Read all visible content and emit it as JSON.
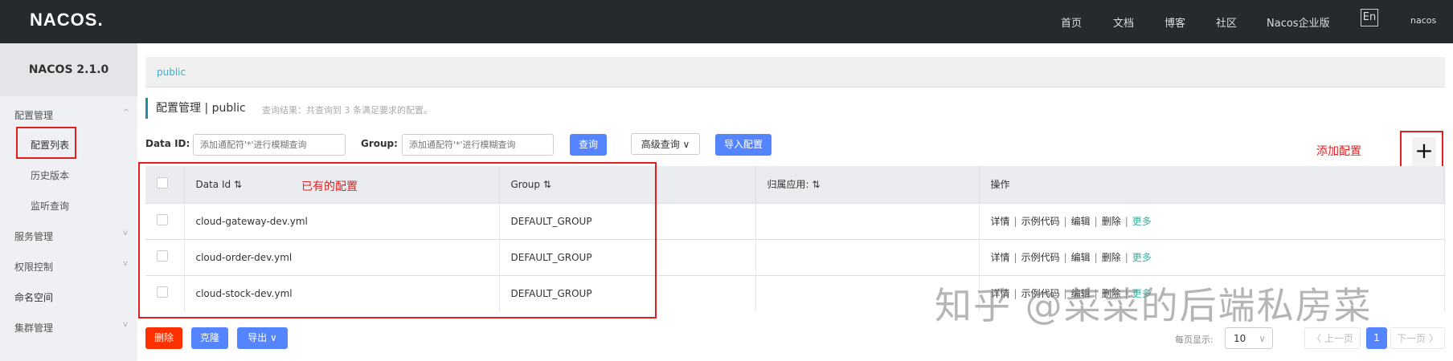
{
  "header": {
    "logo": "NACOS.",
    "nav": [
      "首页",
      "文档",
      "博客",
      "社区",
      "Nacos企业版"
    ],
    "lang": "En",
    "user": "nacos"
  },
  "sidebar": {
    "version": "NACOS 2.1.0",
    "items": [
      {
        "label": "配置管理",
        "chev": "^"
      },
      {
        "label": "配置列表"
      },
      {
        "label": "历史版本"
      },
      {
        "label": "监听查询"
      },
      {
        "label": "服务管理",
        "chev": "v"
      },
      {
        "label": "权限控制",
        "chev": "v"
      },
      {
        "label": "命名空间"
      },
      {
        "label": "集群管理",
        "chev": "v"
      }
    ]
  },
  "breadcrumb": "public",
  "page": {
    "title": "配置管理 | public",
    "result": "查询结果：共查询到 3 条满足要求的配置。"
  },
  "search": {
    "dataid_label": "Data ID:",
    "dataid_placeholder": "添加通配符'*'进行模糊查询",
    "group_label": "Group:",
    "group_placeholder": "添加通配符'*'进行模糊查询",
    "query": "查询",
    "advanced": "高级查询 ∨",
    "import": "导入配置"
  },
  "annotations": {
    "existing": "已有的配置",
    "add": "添加配置"
  },
  "add_icon": "+",
  "table": {
    "headers": [
      "Data Id ⇅",
      "Group ⇅",
      "归属应用: ⇅",
      "操作"
    ],
    "rows": [
      {
        "dataid": "cloud-gateway-dev.yml",
        "group": "DEFAULT_GROUP"
      },
      {
        "dataid": "cloud-order-dev.yml",
        "group": "DEFAULT_GROUP"
      },
      {
        "dataid": "cloud-stock-dev.yml",
        "group": "DEFAULT_GROUP"
      }
    ],
    "ops": [
      "详情",
      "示例代码",
      "编辑",
      "删除",
      "更多"
    ]
  },
  "footer": {
    "delete": "删除",
    "clone": "克隆",
    "export": "导出 ∨",
    "page_size_label": "每页显示:",
    "page_size": "10",
    "prev": "〈 上一页",
    "page": "1",
    "next": "下一页 〉"
  },
  "watermark": "知乎 @菜菜的后端私房菜",
  "colors": {
    "header": "#252a2f",
    "primary": "#5584ff",
    "danger": "#ff3000",
    "annotation": "#e02020"
  }
}
